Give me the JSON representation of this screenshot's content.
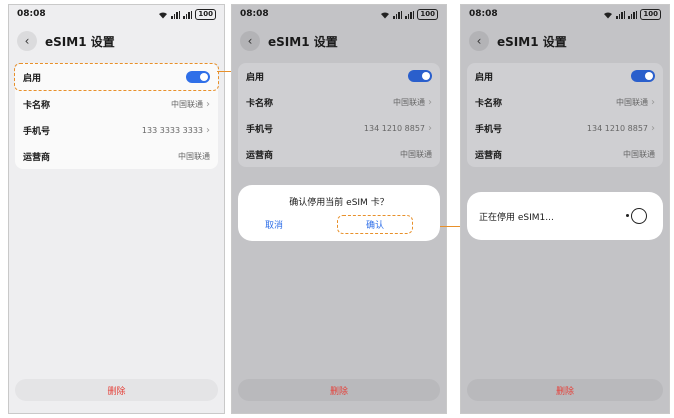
{
  "status": {
    "time": "08:08",
    "battery": "100"
  },
  "header": {
    "title": "eSIM1 设置"
  },
  "settings": {
    "enable_label": "启用",
    "card_name_label": "卡名称",
    "card_name_value": "中国联通",
    "phone_label": "手机号",
    "phone_value_1": "133 3333 3333",
    "phone_value_2": "134 1210 8857",
    "carrier_label": "运营商",
    "carrier_value": "中国联通"
  },
  "actions": {
    "delete_label": "删除"
  },
  "confirm_dialog": {
    "question": "确认停用当前 eSIM 卡？",
    "cancel": "取消",
    "confirm": "确认"
  },
  "progress_dialog": {
    "text": "正在停用 eSIM1..."
  },
  "colors": {
    "accent": "#2f6fe8",
    "danger": "#e5413a",
    "highlight": "#e8902a"
  },
  "icons": {
    "back": "chevron-left-icon",
    "chevron": "chevron-right-icon",
    "wifi": "wifi-icon",
    "signal": "signal-icon",
    "battery": "battery-icon",
    "spinner": "spinner-icon"
  }
}
